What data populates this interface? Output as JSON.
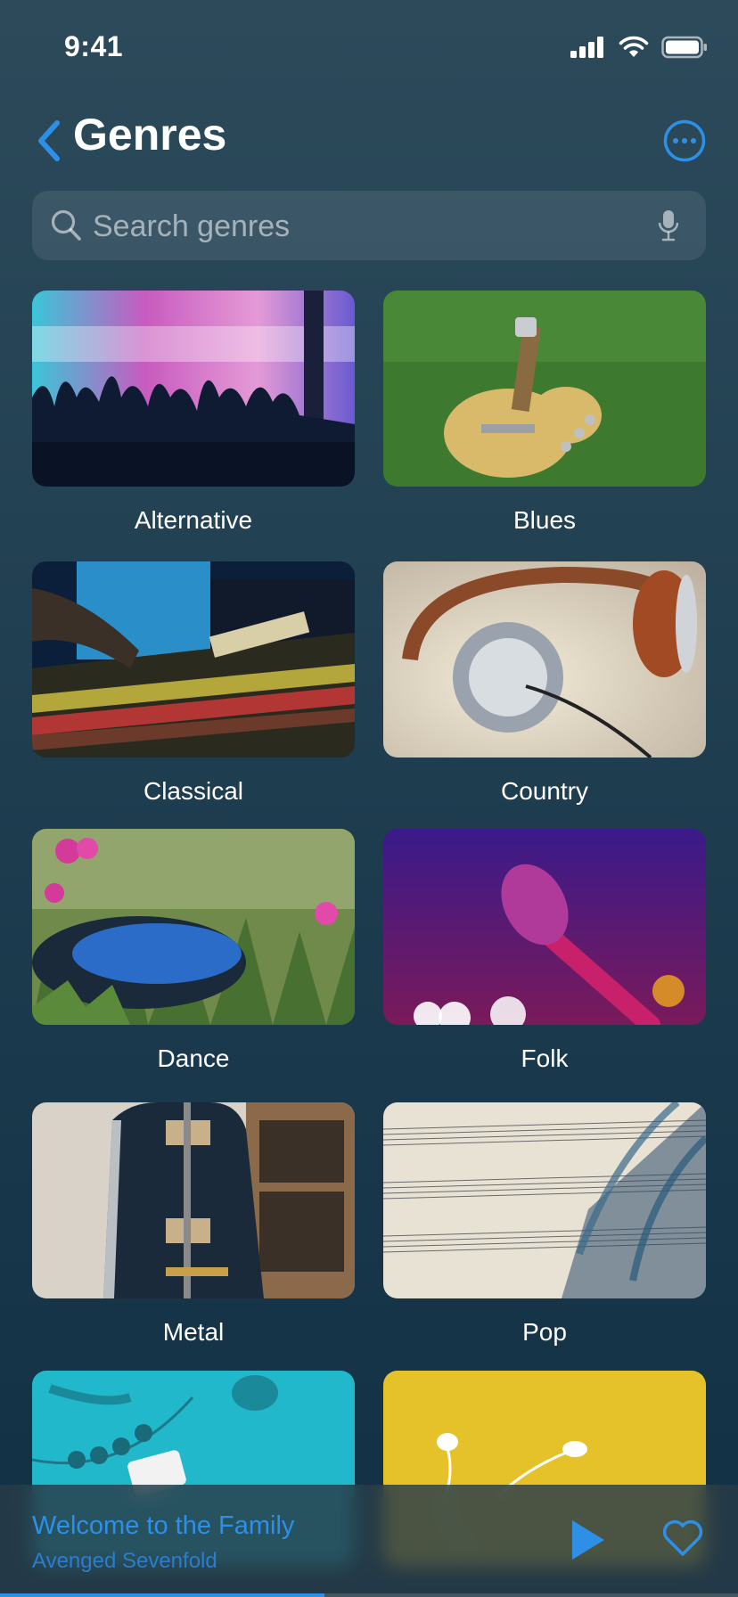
{
  "status": {
    "time": "9:41"
  },
  "header": {
    "title": "Genres"
  },
  "search": {
    "placeholder": "Search genres"
  },
  "genres": [
    {
      "label": "Alternative"
    },
    {
      "label": "Blues"
    },
    {
      "label": "Classical"
    },
    {
      "label": "Country"
    },
    {
      "label": "Dance"
    },
    {
      "label": "Folk"
    },
    {
      "label": "Metal"
    },
    {
      "label": "Pop"
    },
    {
      "label": ""
    },
    {
      "label": ""
    }
  ],
  "player": {
    "song": "Welcome to the Family",
    "artist": "Avenged Sevenfold",
    "progress": 0.44
  },
  "colors": {
    "accent": "#2e8fe6",
    "background": "#1f3e50"
  }
}
